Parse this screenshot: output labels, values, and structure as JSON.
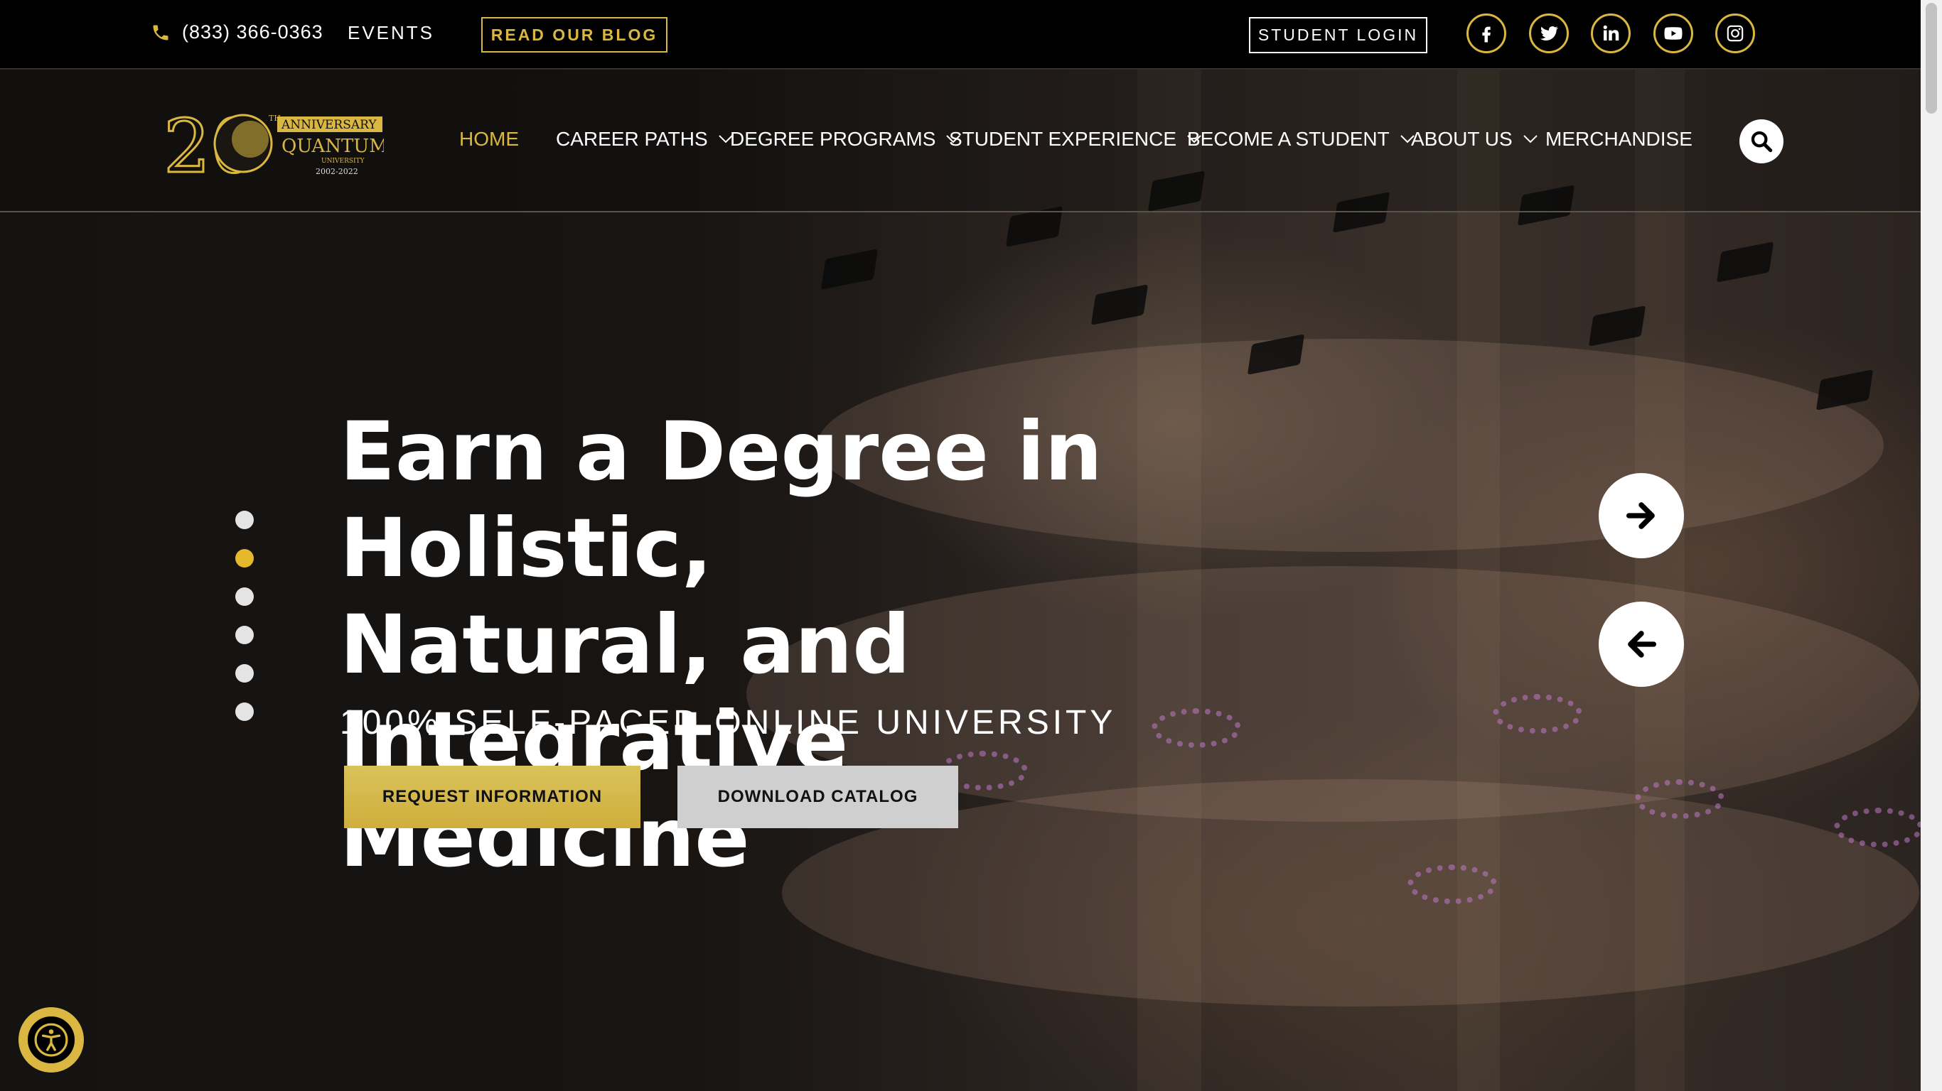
{
  "topbar": {
    "phone": "(833) 366-0363",
    "events": "EVENTS",
    "blog_button": "READ OUR BLOG",
    "login_button": "STUDENT LOGIN",
    "social": [
      "facebook-icon",
      "twitter-icon",
      "linkedin-icon",
      "youtube-icon",
      "instagram-icon"
    ]
  },
  "logo": {
    "number": "20",
    "superscript": "TH",
    "anniversary": "ANNIVERSARY",
    "name": "QUANTUM",
    "sub": "UNIVERSITY",
    "years": "2002-2022"
  },
  "nav": {
    "items": [
      {
        "label": "HOME",
        "active": true
      },
      {
        "label": "CAREER PATHS"
      },
      {
        "label": "DEGREE PROGRAMS"
      },
      {
        "label": "STUDENT EXPERIENCE"
      },
      {
        "label": "BECOME A STUDENT"
      },
      {
        "label": "ABOUT US"
      },
      {
        "label": "MERCHANDISE"
      }
    ],
    "search_icon": "search-icon"
  },
  "hero": {
    "headline_line1": "Earn a Degree in Holistic,",
    "headline_line2": "Natural, and Integrative",
    "headline_line3": "Medicine",
    "subheadline": "100% SELF-PACED ONLINE UNIVERSITY",
    "request_button": "REQUEST INFORMATION",
    "catalog_button": "DOWNLOAD CATALOG",
    "slide_count": 6,
    "active_slide": 2,
    "next_icon": "arrow-right-icon",
    "prev_icon": "arrow-left-icon"
  },
  "colors": {
    "gold": "#d9b740",
    "topbar_bg": "#000000",
    "button_gold": "#d4b84a",
    "button_gray": "#cfcfcf"
  },
  "accessibility": {
    "icon": "accessibility-icon"
  }
}
